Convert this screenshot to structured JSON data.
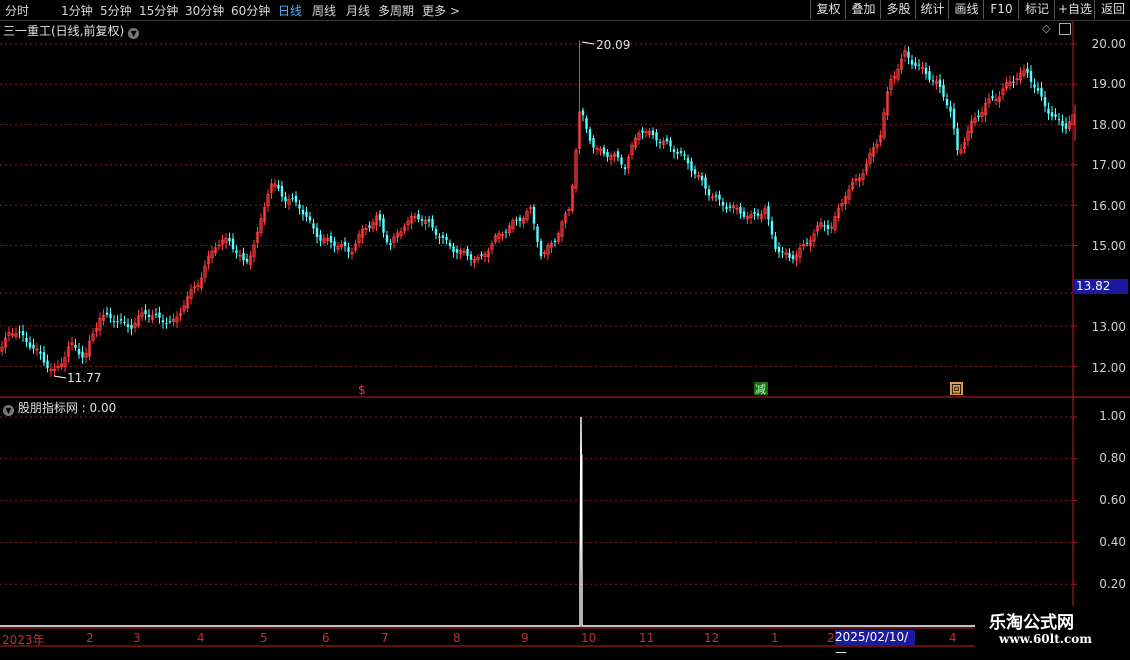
{
  "toolbar": {
    "periods": [
      "分时",
      "1分钟",
      "5分钟",
      "15分钟",
      "30分钟",
      "60分钟",
      "日线",
      "周线",
      "月线",
      "多周期",
      "更多 >"
    ],
    "active_period": "日线",
    "right_buttons": [
      "复权",
      "叠加",
      "多股",
      "统计",
      "画线",
      "F10",
      "+自选",
      "返回"
    ]
  },
  "stock": {
    "title": "三一重工(日线,前复权)"
  },
  "indicator": {
    "title": "股朋指标网 : 0.00"
  },
  "price_axis": [
    "20.00",
    "19.00",
    "18.00",
    "17.00",
    "16.00",
    "15.00",
    "13.00",
    "12.00"
  ],
  "current_price": "13.82",
  "high_label": "20.09",
  "low_label": "11.77",
  "markers": [
    "$",
    "减",
    "回"
  ],
  "ind_axis": [
    "1.00",
    "0.80",
    "0.60",
    "0.40",
    "0.20"
  ],
  "x_axis": {
    "months": [
      "2023年",
      "2",
      "3",
      "4",
      "5",
      "6",
      "7",
      "8",
      "9",
      "10",
      "11",
      "12",
      "1",
      "2",
      "4"
    ],
    "highlight_date": "2025/02/10/—"
  },
  "watermark": {
    "line1": "乐淘公式网",
    "line2": "www.60lt.com"
  },
  "colors": {
    "up": "#ff3c3c",
    "down": "#54ffff",
    "grid": "#8a1a1a",
    "indicator": "#ffffff"
  },
  "chart_data": [
    {
      "type": "candlestick",
      "title": "三一重工(日线,前复权)",
      "ylim": [
        11.6,
        20.35
      ],
      "y_ticks": [
        20,
        19,
        18,
        17,
        16,
        15,
        13,
        12
      ],
      "high": 20.09,
      "low": 11.77,
      "last": 13.82,
      "close_path": [
        [
          0,
          12.35
        ],
        [
          10,
          12.85
        ],
        [
          25,
          12.55
        ],
        [
          40,
          12.3
        ],
        [
          55,
          11.95
        ],
        [
          70,
          12.55
        ],
        [
          85,
          12.1
        ],
        [
          100,
          13.2
        ],
        [
          115,
          13.3
        ],
        [
          130,
          13.05
        ],
        [
          145,
          13.25
        ],
        [
          160,
          13.05
        ],
        [
          175,
          13.15
        ],
        [
          185,
          13.75
        ],
        [
          200,
          14.2
        ],
        [
          215,
          14.9
        ],
        [
          230,
          15.05
        ],
        [
          245,
          14.6
        ],
        [
          258,
          15.4
        ],
        [
          270,
          16.55
        ],
        [
          285,
          16.05
        ],
        [
          300,
          15.95
        ],
        [
          320,
          15.3
        ],
        [
          335,
          15.05
        ],
        [
          350,
          14.7
        ],
        [
          365,
          15.4
        ],
        [
          378,
          15.8
        ],
        [
          390,
          15.1
        ],
        [
          405,
          15.5
        ],
        [
          420,
          15.6
        ],
        [
          440,
          15.3
        ],
        [
          460,
          14.9
        ],
        [
          480,
          14.5
        ],
        [
          495,
          15.1
        ],
        [
          510,
          15.6
        ],
        [
          530,
          15.95
        ],
        [
          542,
          14.6
        ],
        [
          555,
          15.05
        ],
        [
          570,
          16.0
        ],
        [
          580,
          18.5
        ],
        [
          595,
          17.4
        ],
        [
          610,
          17.15
        ],
        [
          625,
          16.9
        ],
        [
          640,
          18.0
        ],
        [
          655,
          17.8
        ],
        [
          670,
          17.4
        ],
        [
          690,
          16.9
        ],
        [
          710,
          16.4
        ],
        [
          730,
          15.95
        ],
        [
          750,
          15.55
        ],
        [
          765,
          15.9
        ],
        [
          775,
          15.1
        ],
        [
          790,
          14.75
        ],
        [
          805,
          14.9
        ],
        [
          820,
          15.4
        ],
        [
          832,
          15.5
        ],
        [
          845,
          16.4
        ],
        [
          865,
          16.9
        ],
        [
          880,
          17.6
        ],
        [
          890,
          19.0
        ],
        [
          905,
          19.85
        ],
        [
          920,
          19.5
        ],
        [
          935,
          19.0
        ],
        [
          950,
          18.3
        ],
        [
          958,
          17.2
        ],
        [
          970,
          18.05
        ],
        [
          985,
          18.6
        ],
        [
          1000,
          18.7
        ],
        [
          1015,
          19.05
        ],
        [
          1028,
          19.3
        ],
        [
          1040,
          18.8
        ],
        [
          1055,
          18.2
        ],
        [
          1065,
          17.9
        ],
        [
          1075,
          18.1
        ]
      ]
    },
    {
      "type": "line",
      "title": "股朋指标网",
      "ylim": [
        0,
        1.05
      ],
      "y_ticks": [
        1.0,
        0.8,
        0.6,
        0.4,
        0.2
      ],
      "baseline": 0,
      "spike_value": 1.0
    }
  ]
}
